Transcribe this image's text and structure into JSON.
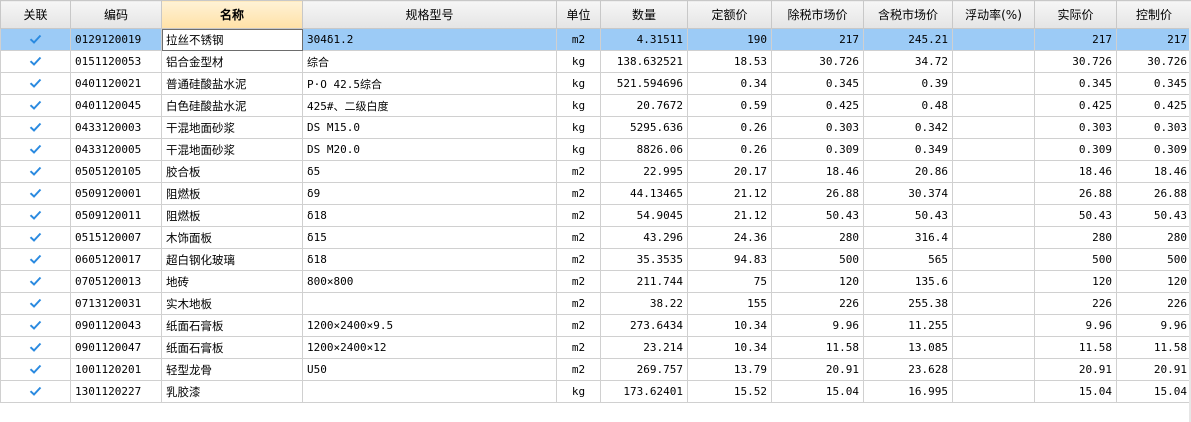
{
  "columns": [
    "关联",
    "编码",
    "名称",
    "规格型号",
    "单位",
    "数量",
    "定额价",
    "除税市场价",
    "含税市场价",
    "浮动率(%)",
    "实际价",
    "控制价"
  ],
  "rows": [
    {
      "code": "0129120019",
      "name": "拉丝不锈钢",
      "spec": "304δ1.2",
      "unit": "m2",
      "qty": "4.31511",
      "quota": "190",
      "excl": "217",
      "incl": "245.21",
      "float": "",
      "actual": "217",
      "control": "217"
    },
    {
      "code": "0151120053",
      "name": "铝合金型材",
      "spec": "综合",
      "unit": "kg",
      "qty": "138.632521",
      "quota": "18.53",
      "excl": "30.726",
      "incl": "34.72",
      "float": "",
      "actual": "30.726",
      "control": "30.726"
    },
    {
      "code": "0401120021",
      "name": "普通硅酸盐水泥",
      "spec": "P·O 42.5综合",
      "unit": "kg",
      "qty": "521.594696",
      "quota": "0.34",
      "excl": "0.345",
      "incl": "0.39",
      "float": "",
      "actual": "0.345",
      "control": "0.345"
    },
    {
      "code": "0401120045",
      "name": "白色硅酸盐水泥",
      "spec": "425#、二级白度",
      "unit": "kg",
      "qty": "20.7672",
      "quota": "0.59",
      "excl": "0.425",
      "incl": "0.48",
      "float": "",
      "actual": "0.425",
      "control": "0.425"
    },
    {
      "code": "0433120003",
      "name": "干混地面砂浆",
      "spec": "DS M15.0",
      "unit": "kg",
      "qty": "5295.636",
      "quota": "0.26",
      "excl": "0.303",
      "incl": "0.342",
      "float": "",
      "actual": "0.303",
      "control": "0.303"
    },
    {
      "code": "0433120005",
      "name": "干混地面砂浆",
      "spec": "DS M20.0",
      "unit": "kg",
      "qty": "8826.06",
      "quota": "0.26",
      "excl": "0.309",
      "incl": "0.349",
      "float": "",
      "actual": "0.309",
      "control": "0.309"
    },
    {
      "code": "0505120105",
      "name": "胶合板",
      "spec": "δ5",
      "unit": "m2",
      "qty": "22.995",
      "quota": "20.17",
      "excl": "18.46",
      "incl": "20.86",
      "float": "",
      "actual": "18.46",
      "control": "18.46"
    },
    {
      "code": "0509120001",
      "name": "阻燃板",
      "spec": "δ9",
      "unit": "m2",
      "qty": "44.13465",
      "quota": "21.12",
      "excl": "26.88",
      "incl": "30.374",
      "float": "",
      "actual": "26.88",
      "control": "26.88"
    },
    {
      "code": "0509120011",
      "name": "阻燃板",
      "spec": "δ18",
      "unit": "m2",
      "qty": "54.9045",
      "quota": "21.12",
      "excl": "50.43",
      "incl": "50.43",
      "float": "",
      "actual": "50.43",
      "control": "50.43"
    },
    {
      "code": "0515120007",
      "name": "木饰面板",
      "spec": "δ15",
      "unit": "m2",
      "qty": "43.296",
      "quota": "24.36",
      "excl": "280",
      "incl": "316.4",
      "float": "",
      "actual": "280",
      "control": "280"
    },
    {
      "code": "0605120017",
      "name": "超白钢化玻璃",
      "spec": "δ18",
      "unit": "m2",
      "qty": "35.3535",
      "quota": "94.83",
      "excl": "500",
      "incl": "565",
      "float": "",
      "actual": "500",
      "control": "500"
    },
    {
      "code": "0705120013",
      "name": "地砖",
      "spec": "800×800",
      "unit": "m2",
      "qty": "211.744",
      "quota": "75",
      "excl": "120",
      "incl": "135.6",
      "float": "",
      "actual": "120",
      "control": "120"
    },
    {
      "code": "0713120031",
      "name": "实木地板",
      "spec": "",
      "unit": "m2",
      "qty": "38.22",
      "quota": "155",
      "excl": "226",
      "incl": "255.38",
      "float": "",
      "actual": "226",
      "control": "226"
    },
    {
      "code": "0901120043",
      "name": "纸面石膏板",
      "spec": "1200×2400×9.5",
      "unit": "m2",
      "qty": "273.6434",
      "quota": "10.34",
      "excl": "9.96",
      "incl": "11.255",
      "float": "",
      "actual": "9.96",
      "control": "9.96"
    },
    {
      "code": "0901120047",
      "name": "纸面石膏板",
      "spec": "1200×2400×12",
      "unit": "m2",
      "qty": "23.214",
      "quota": "10.34",
      "excl": "11.58",
      "incl": "13.085",
      "float": "",
      "actual": "11.58",
      "control": "11.58"
    },
    {
      "code": "1001120201",
      "name": "轻型龙骨",
      "spec": "U50",
      "unit": "m2",
      "qty": "269.757",
      "quota": "13.79",
      "excl": "20.91",
      "incl": "23.628",
      "float": "",
      "actual": "20.91",
      "control": "20.91"
    },
    {
      "code": "1301120227",
      "name": "乳胶漆",
      "spec": "",
      "unit": "kg",
      "qty": "173.62401",
      "quota": "15.52",
      "excl": "15.04",
      "incl": "16.995",
      "float": "",
      "actual": "15.04",
      "control": "15.04"
    }
  ],
  "selected_row": 0,
  "sorted_column": 2,
  "colors": {
    "selection": "#9ccbf6",
    "check": "#2a8ae0",
    "sorted_header": "#ffe1a6"
  }
}
